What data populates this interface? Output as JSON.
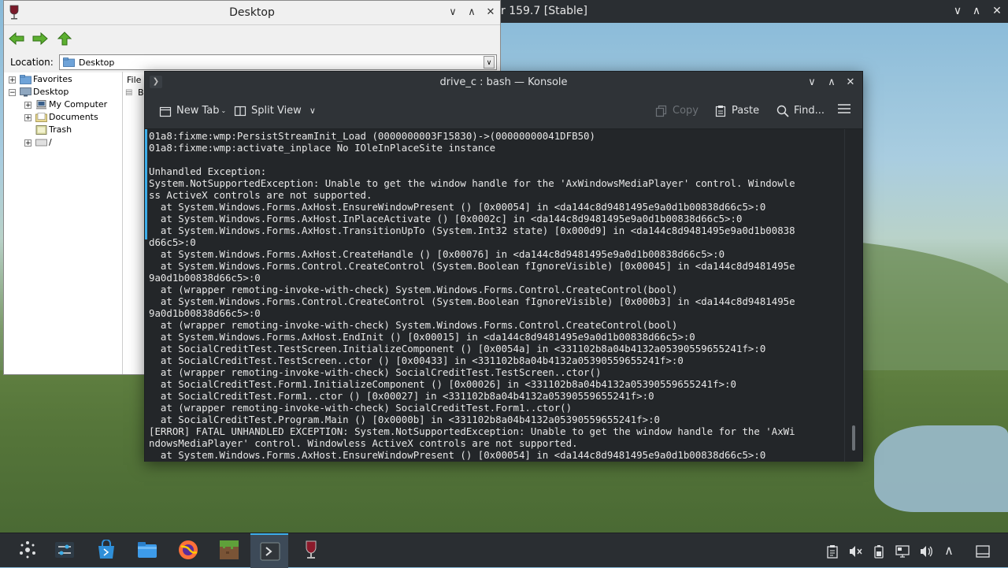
{
  "desktop": {
    "bg_window_title": "r 159.7 [Stable]"
  },
  "wine_explorer": {
    "title": "Desktop",
    "location_label": "Location:",
    "location_value": "Desktop",
    "tree": [
      {
        "label": "Favorites",
        "expander": "+"
      },
      {
        "label": "Desktop",
        "expander": "−"
      },
      {
        "label": "My Computer",
        "expander": "+"
      },
      {
        "label": "Documents",
        "expander": "+"
      },
      {
        "label": "Trash",
        "expander": ""
      },
      {
        "label": "/",
        "expander": "+"
      }
    ],
    "list_header": "File",
    "list_item_partial": "B"
  },
  "konsole": {
    "title": "drive_c : bash — Konsole",
    "toolbar": {
      "new_tab": "New Tab",
      "split_view": "Split View",
      "copy": "Copy",
      "paste": "Paste",
      "find": "Find..."
    },
    "lines": [
      "01a8:fixme:wmp:PersistStreamInit_Load (0000000003F15830)->(00000000041DFB50)",
      "01a8:fixme:wmp:activate_inplace No IOleInPlaceSite instance",
      "",
      "Unhandled Exception:",
      "System.NotSupportedException: Unable to get the window handle for the 'AxWindowsMediaPlayer' control. Windowle",
      "ss ActiveX controls are not supported.",
      "  at System.Windows.Forms.AxHost.EnsureWindowPresent () [0x00054] in <da144c8d9481495e9a0d1b00838d66c5>:0",
      "  at System.Windows.Forms.AxHost.InPlaceActivate () [0x0002c] in <da144c8d9481495e9a0d1b00838d66c5>:0",
      "  at System.Windows.Forms.AxHost.TransitionUpTo (System.Int32 state) [0x000d9] in <da144c8d9481495e9a0d1b00838",
      "d66c5>:0",
      "  at System.Windows.Forms.AxHost.CreateHandle () [0x00076] in <da144c8d9481495e9a0d1b00838d66c5>:0",
      "  at System.Windows.Forms.Control.CreateControl (System.Boolean fIgnoreVisible) [0x00045] in <da144c8d9481495e",
      "9a0d1b00838d66c5>:0",
      "  at (wrapper remoting-invoke-with-check) System.Windows.Forms.Control.CreateControl(bool)",
      "  at System.Windows.Forms.Control.CreateControl (System.Boolean fIgnoreVisible) [0x000b3] in <da144c8d9481495e",
      "9a0d1b00838d66c5>:0",
      "  at (wrapper remoting-invoke-with-check) System.Windows.Forms.Control.CreateControl(bool)",
      "  at System.Windows.Forms.AxHost.EndInit () [0x00015] in <da144c8d9481495e9a0d1b00838d66c5>:0",
      "  at SocialCreditTest.TestScreen.InitializeComponent () [0x0054a] in <331102b8a04b4132a05390559655241f>:0",
      "  at SocialCreditTest.TestScreen..ctor () [0x00433] in <331102b8a04b4132a05390559655241f>:0",
      "  at (wrapper remoting-invoke-with-check) SocialCreditTest.TestScreen..ctor()",
      "  at SocialCreditTest.Form1.InitializeComponent () [0x00026] in <331102b8a04b4132a05390559655241f>:0",
      "  at SocialCreditTest.Form1..ctor () [0x00027] in <331102b8a04b4132a05390559655241f>:0",
      "  at (wrapper remoting-invoke-with-check) SocialCreditTest.Form1..ctor()",
      "  at SocialCreditTest.Program.Main () [0x0000b] in <331102b8a04b4132a05390559655241f>:0",
      "[ERROR] FATAL UNHANDLED EXCEPTION: System.NotSupportedException: Unable to get the window handle for the 'AxWi",
      "ndowsMediaPlayer' control. Windowless ActiveX controls are not supported.",
      "  at System.Windows.Forms.AxHost.EnsureWindowPresent () [0x00054] in <da144c8d9481495e9a0d1b00838d66c5>:0"
    ]
  },
  "taskbar": {
    "apps": [
      "application-launcher-icon",
      "system-settings-icon",
      "discover-store-icon",
      "dolphin-files-icon",
      "firefox-icon",
      "minecraft-icon",
      "konsole-icon",
      "wine-icon"
    ],
    "tray": [
      "clipboard-icon",
      "audio-muted-icon",
      "battery-icon",
      "display-config-icon",
      "volume-icon",
      "tray-expand-icon",
      "show-desktop-icon"
    ]
  },
  "colors": {
    "accent": "#3daee9",
    "panel": "#2a2e32",
    "terminal_bg": "#232629"
  }
}
